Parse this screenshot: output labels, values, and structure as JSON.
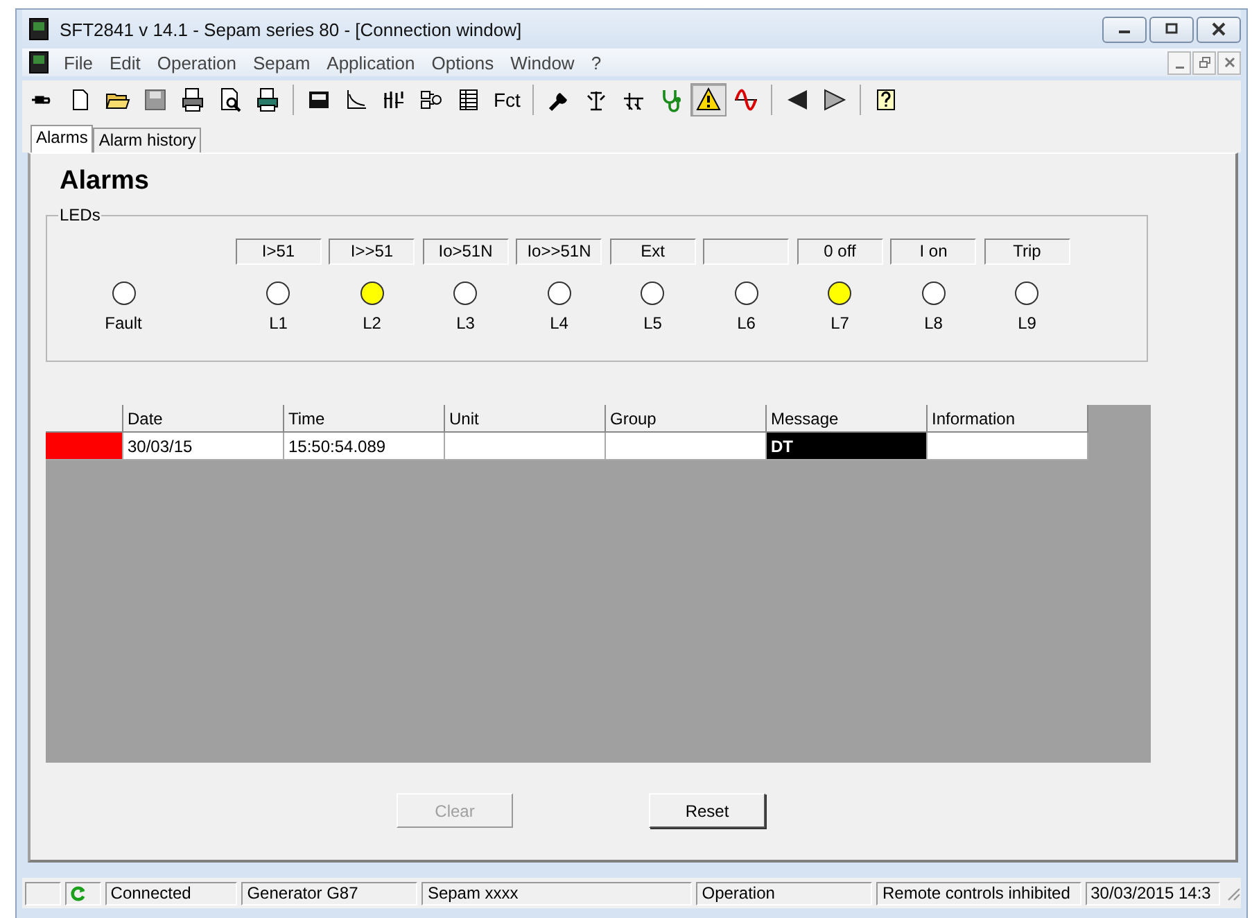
{
  "window": {
    "title": "SFT2841  v 14.1 - Sepam series 80 - [Connection window]"
  },
  "menu": [
    "File",
    "Edit",
    "Operation",
    "Sepam",
    "Application",
    "Options",
    "Window",
    "?"
  ],
  "toolbar": [
    {
      "selected": false
    },
    {
      "selected": false
    },
    {
      "selected": false
    },
    {
      "selected": false
    },
    {
      "selected": false
    },
    {
      "selected": false
    },
    {
      "selected": false
    },
    {
      "selected": false
    },
    {
      "selected": false
    },
    {
      "selected": false
    },
    {
      "selected": false
    },
    {
      "selected": false
    },
    {
      "label": "Fct",
      "selected": false
    },
    {
      "selected": false
    },
    {
      "selected": false
    },
    {
      "selected": false
    },
    {
      "selected": false
    },
    {
      "selected": true
    },
    {
      "selected": false
    },
    {
      "selected": false
    },
    {
      "selected": false
    },
    {
      "selected": false
    }
  ],
  "tabs": [
    {
      "label": "Alarms",
      "selected": true
    },
    {
      "label": "Alarm history",
      "selected": false
    }
  ],
  "heading": "Alarms",
  "leds": {
    "title": "LEDs",
    "items": [
      {
        "kind": "fault",
        "name": "Fault",
        "on": false
      },
      {
        "kind": "labelled",
        "label": "I>51",
        "name": "L1",
        "on": false
      },
      {
        "kind": "labelled",
        "label": "I>>51",
        "name": "L2",
        "on": true
      },
      {
        "kind": "labelled",
        "label": "Io>51N",
        "name": "L3",
        "on": false
      },
      {
        "kind": "labelled",
        "label": "Io>>51N",
        "name": "L4",
        "on": false
      },
      {
        "kind": "labelled",
        "label": "Ext",
        "name": "L5",
        "on": false
      },
      {
        "kind": "labelled",
        "name": "L6",
        "on": false
      },
      {
        "kind": "labelled",
        "label": "0 off",
        "name": "L7",
        "on": true
      },
      {
        "kind": "labelled",
        "label": "I on",
        "name": "L8",
        "on": false
      },
      {
        "kind": "labelled",
        "label": "Trip",
        "name": "L9",
        "on": false
      }
    ]
  },
  "table": {
    "columns": [
      "Date",
      "Time",
      "Unit",
      "Group",
      "Message",
      "Information"
    ],
    "rows": [
      {
        "color": "#ff0000",
        "cells": [
          {
            "text": "30/03/15",
            "selected": false
          },
          {
            "text": "15:50:54.089",
            "selected": false
          },
          {
            "selected": false
          },
          {
            "selected": false
          },
          {
            "text": "DT",
            "selected": true
          },
          {
            "selected": false
          }
        ]
      }
    ]
  },
  "buttons": [
    {
      "label": "Clear",
      "disabled": true
    },
    {
      "label": "Reset",
      "disabled": false
    }
  ],
  "status_bar": [
    {
      "kind": "blank"
    },
    {
      "kind": "connection-icon"
    },
    {
      "kind": "text",
      "text": "Connected"
    },
    {
      "kind": "text",
      "text": "Generator G87"
    },
    {
      "kind": "text",
      "text": "Sepam xxxx"
    },
    {
      "kind": "text",
      "text": "Operation"
    },
    {
      "kind": "text",
      "text": "Remote controls inhibited"
    },
    {
      "kind": "text",
      "text": "30/03/2015  14:3"
    }
  ]
}
